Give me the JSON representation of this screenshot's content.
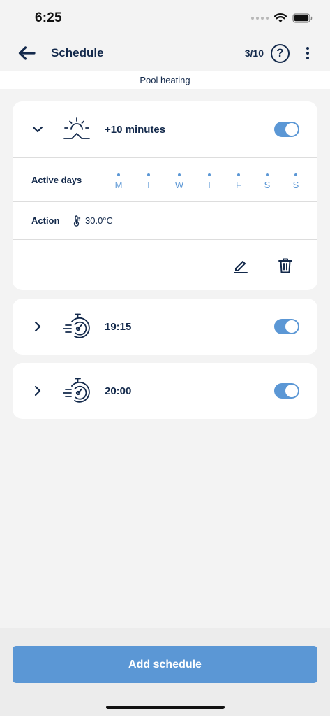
{
  "status_bar": {
    "time": "6:25"
  },
  "app_bar": {
    "title": "Schedule",
    "counter": "3/10",
    "help_label": "?"
  },
  "subtitle": "Pool heating",
  "schedules": [
    {
      "label": "+10 minutes",
      "icon": "sunrise-icon",
      "expanded": true,
      "enabled": true,
      "active_days_label": "Active days",
      "days": [
        "M",
        "T",
        "W",
        "T",
        "F",
        "S",
        "S"
      ],
      "action_label": "Action",
      "action_value": "30.0°C"
    },
    {
      "label": "19:15",
      "icon": "timer-icon",
      "expanded": false,
      "enabled": true
    },
    {
      "label": "20:00",
      "icon": "timer-icon",
      "expanded": false,
      "enabled": true
    }
  ],
  "add_button_label": "Add schedule",
  "colors": {
    "accent": "#5b97d5",
    "navy": "#13294b",
    "background": "#f3f3f3"
  }
}
